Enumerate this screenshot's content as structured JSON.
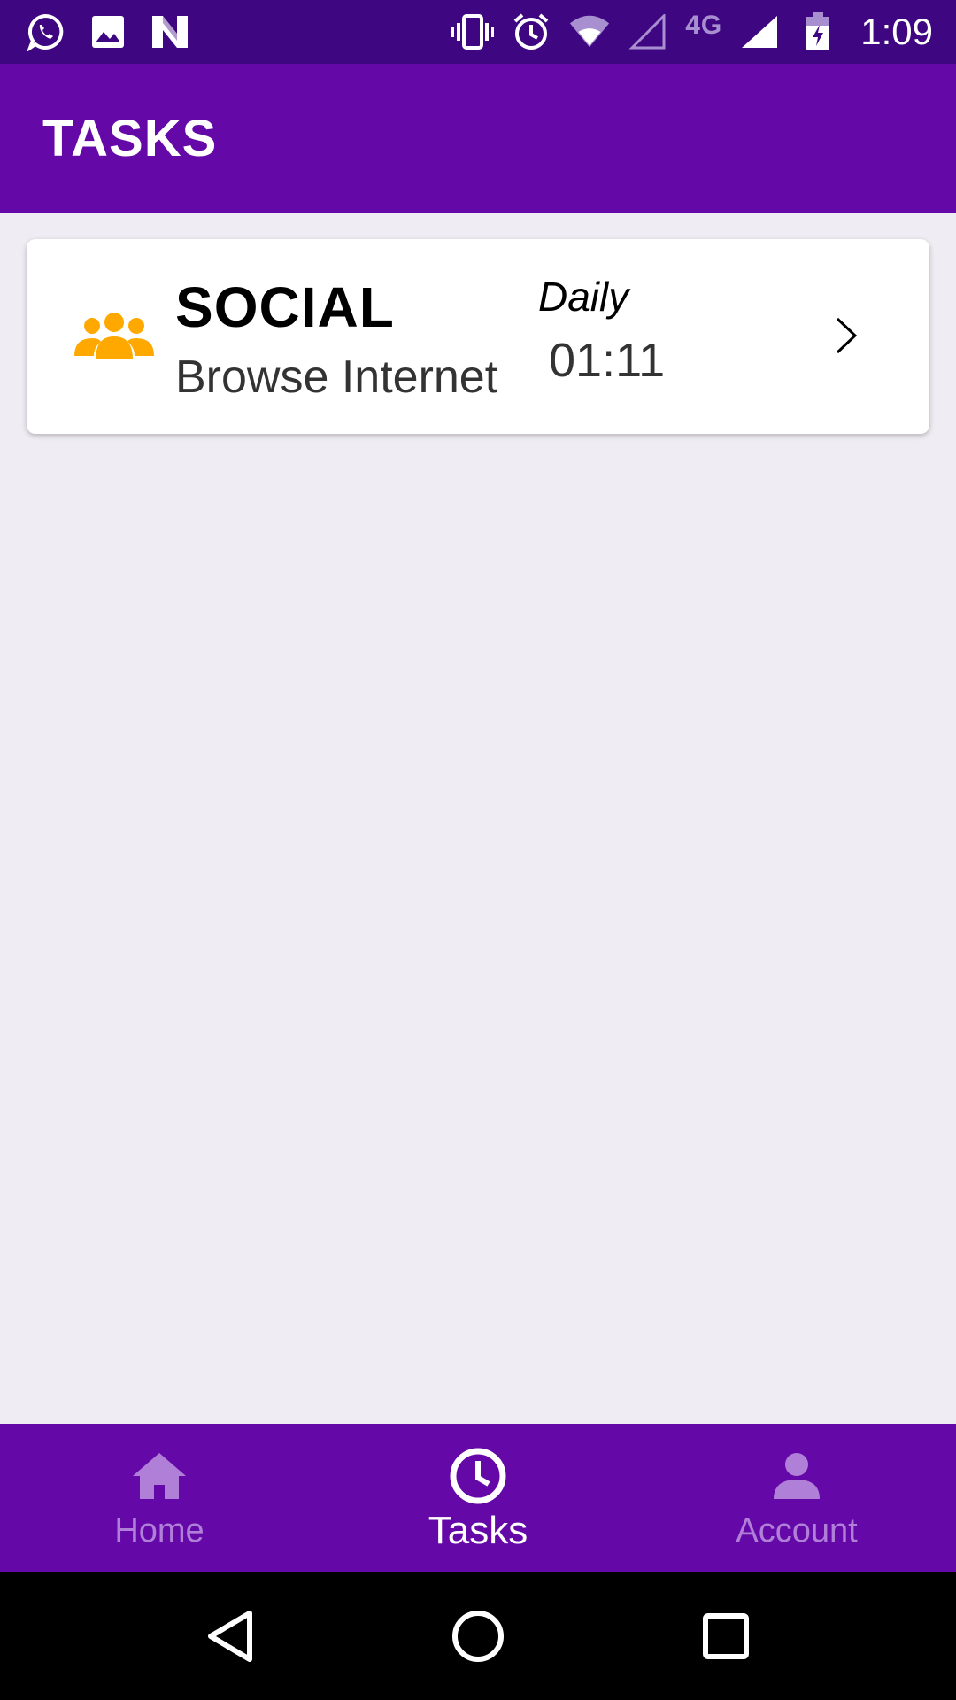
{
  "status_bar": {
    "network_label": "4G",
    "time": "1:09",
    "icons": [
      "whatsapp-icon",
      "image-icon",
      "n-app-icon",
      "vibrate-icon",
      "alarm-icon",
      "wifi-icon",
      "signal-empty-icon",
      "signal-full-icon",
      "battery-charging-icon"
    ]
  },
  "app_bar": {
    "title": "TASKS"
  },
  "tasks": [
    {
      "category": "SOCIAL",
      "name": "Browse Internet",
      "frequency": "Daily",
      "time": "01:11",
      "icon": "group-icon",
      "icon_color": "#ffa800"
    }
  ],
  "bottom_nav": {
    "items": [
      {
        "label": "Home",
        "icon": "home-icon",
        "active": false
      },
      {
        "label": "Tasks",
        "icon": "clock-icon",
        "active": true
      },
      {
        "label": "Account",
        "icon": "person-icon",
        "active": false
      }
    ]
  },
  "system_nav": {
    "icons": [
      "back-icon",
      "home-circle-icon",
      "recents-icon"
    ]
  },
  "colors": {
    "status_bar": "#3f0682",
    "primary": "#6508a8",
    "background": "#f0ecf3",
    "inactive_nav": "#b07fd8",
    "accent": "#ffa800"
  }
}
